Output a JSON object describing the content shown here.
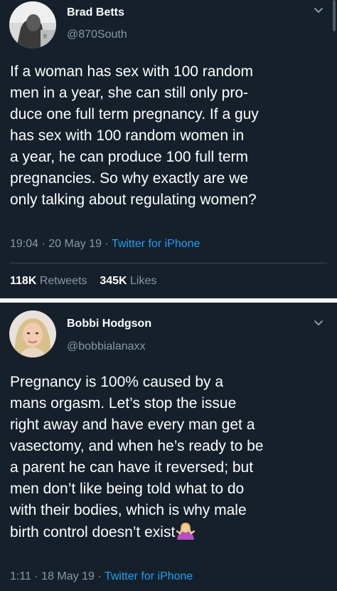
{
  "tweet1": {
    "name": "Brad Betts",
    "handle": "@870South",
    "text_lines": [
      "If a woman has sex with 100 random",
      "men in a year, she can still only pro-",
      "duce one full term pregnancy. If a guy",
      "has sex with 100 random women in",
      "a year, he can produce 100 full term",
      "pregnancies. So why exactly are we",
      "only talking about regulating women?"
    ],
    "time": "19:04",
    "date": "20 May 19",
    "separator": " · ",
    "source": "Twitter for iPhone",
    "retweets_count": "118K",
    "retweets_label": "Retweets",
    "likes_count": "345K",
    "likes_label": "Likes",
    "icons": [
      "avatar",
      "chevron-down-icon"
    ]
  },
  "tweet2": {
    "name": "Bobbi Hodgson",
    "handle": "@bobbialanaxx",
    "text_lines": [
      "Pregnancy is 100% caused by a",
      "mans orgasm. Let’s stop the issue",
      "right away and have every man get a",
      "vasectomy, and when he’s ready to be",
      "a parent he can have it reversed; but",
      "men don’t like being told what to do",
      "with their bodies, which is why male",
      "birth control doesn’t exist"
    ],
    "time": "1:11",
    "date": "18 May 19",
    "separator": " · ",
    "source": "Twitter for iPhone",
    "icons": [
      "avatar",
      "chevron-down-icon",
      "shrug-emoji-icon"
    ]
  },
  "colors": {
    "background": "#15202b",
    "text": "#ffffff",
    "secondary": "#8899a6",
    "link": "#1da1f2",
    "rule": "#38444d"
  }
}
